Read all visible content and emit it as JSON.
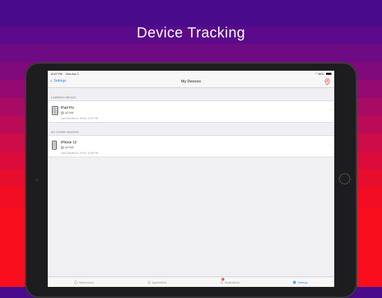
{
  "banner": {
    "title": "Device Tracking"
  },
  "status_bar": {
    "time": "10:07 PM",
    "date": "Mon Apr 3",
    "battery": "66%"
  },
  "nav": {
    "back_label": "Settings",
    "title": "My Devices"
  },
  "sections": {
    "current": {
      "header": "CURRENT DEVICE",
      "device": {
        "name": "iPad Pro",
        "status": "ACTIVE",
        "last_checked": "Last Checked in: 4/3/23, 10:07 PM"
      }
    },
    "other": {
      "header": "MY OTHER DEVICES",
      "device": {
        "name": "iPhone 13",
        "status": "ACTIVE",
        "last_checked": "Last Checked in: 4/3/23, 10:06 PM"
      }
    }
  },
  "tabs": [
    {
      "label": "Watermelon",
      "icon": "watermelon-icon"
    },
    {
      "label": "AppleWatch",
      "icon": "watch-icon"
    },
    {
      "label": "Notifications",
      "icon": "bell-icon",
      "badge": "1"
    },
    {
      "label": "Settings",
      "icon": "gear-icon"
    }
  ],
  "colors": {
    "accent": "#1a82f7",
    "pin": "#ff3b30"
  }
}
